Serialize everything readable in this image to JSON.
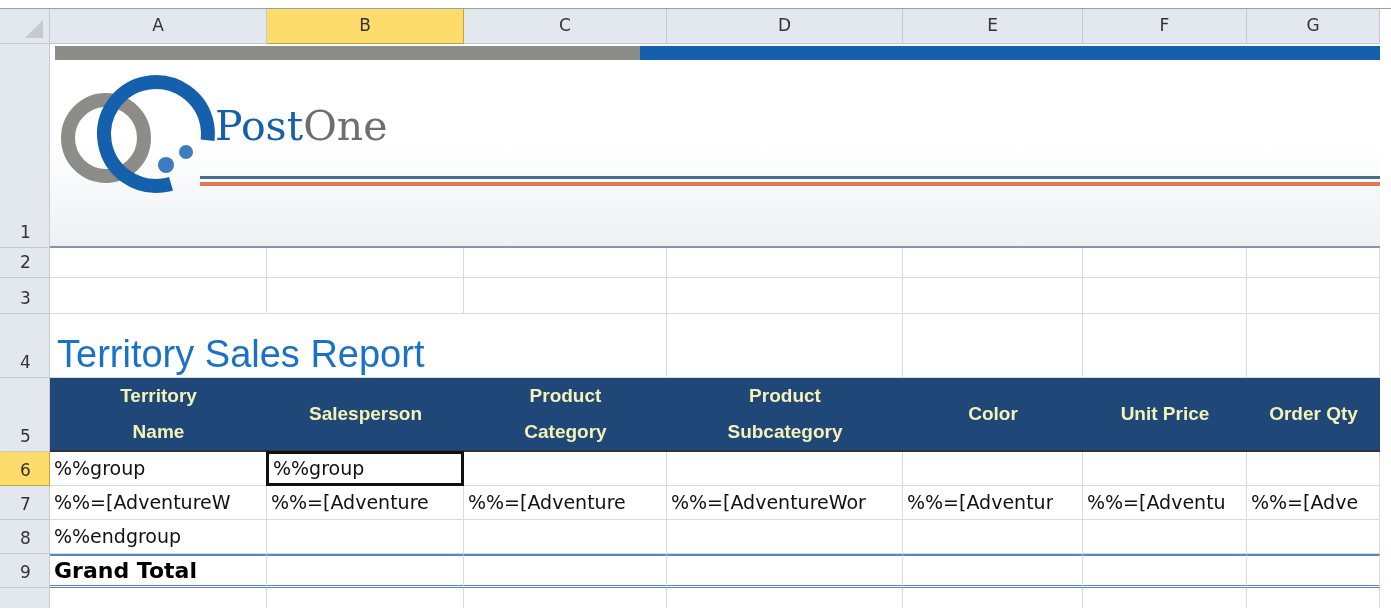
{
  "columns": [
    {
      "label": "A",
      "selected": false
    },
    {
      "label": "B",
      "selected": true
    },
    {
      "label": "C",
      "selected": false
    },
    {
      "label": "D",
      "selected": false
    },
    {
      "label": "E",
      "selected": false
    },
    {
      "label": "F",
      "selected": false
    },
    {
      "label": "G",
      "selected": false
    }
  ],
  "row_headers": [
    {
      "label": "1",
      "selected": false
    },
    {
      "label": "2",
      "selected": false
    },
    {
      "label": "3",
      "selected": false
    },
    {
      "label": "4",
      "selected": false
    },
    {
      "label": "5",
      "selected": false
    },
    {
      "label": "6",
      "selected": true
    },
    {
      "label": "7",
      "selected": false
    },
    {
      "label": "8",
      "selected": false
    },
    {
      "label": "9",
      "selected": false
    }
  ],
  "banner": {
    "logo_text_primary": "Post",
    "logo_text_secondary": "One"
  },
  "title": "Territory Sales Report",
  "table_header": [
    {
      "lines": [
        "Territory",
        "Name"
      ]
    },
    {
      "lines": [
        "Salesperson"
      ]
    },
    {
      "lines": [
        "Product",
        "Category"
      ]
    },
    {
      "lines": [
        "Product",
        "Subcategory"
      ]
    },
    {
      "lines": [
        "Color"
      ]
    },
    {
      "lines": [
        "Unit Price"
      ]
    },
    {
      "lines": [
        "Order Qty"
      ]
    }
  ],
  "body_rows": [
    {
      "kind": "plain",
      "cells": [
        {
          "text": "%%group",
          "selected": false
        },
        {
          "text": "%%group",
          "selected": true
        }
      ]
    },
    {
      "kind": "plain",
      "cells": [
        {
          "text": "%%=[AdventureW",
          "selected": false
        },
        {
          "text": "%%=[Adventure",
          "selected": false
        },
        {
          "text": "%%=[Adventure",
          "selected": false
        },
        {
          "text": "%%=[AdventureWor",
          "selected": false
        },
        {
          "text": "%%=[Adventur",
          "selected": false
        },
        {
          "text": "%%=[Adventu",
          "selected": false
        },
        {
          "text": "%%=[Adve",
          "selected": false
        }
      ]
    },
    {
      "kind": "plain",
      "cells": [
        {
          "text": "%%endgroup",
          "selected": false
        }
      ]
    },
    {
      "kind": "total",
      "cells": [
        {
          "text": "Grand Total",
          "selected": false
        }
      ]
    }
  ]
}
